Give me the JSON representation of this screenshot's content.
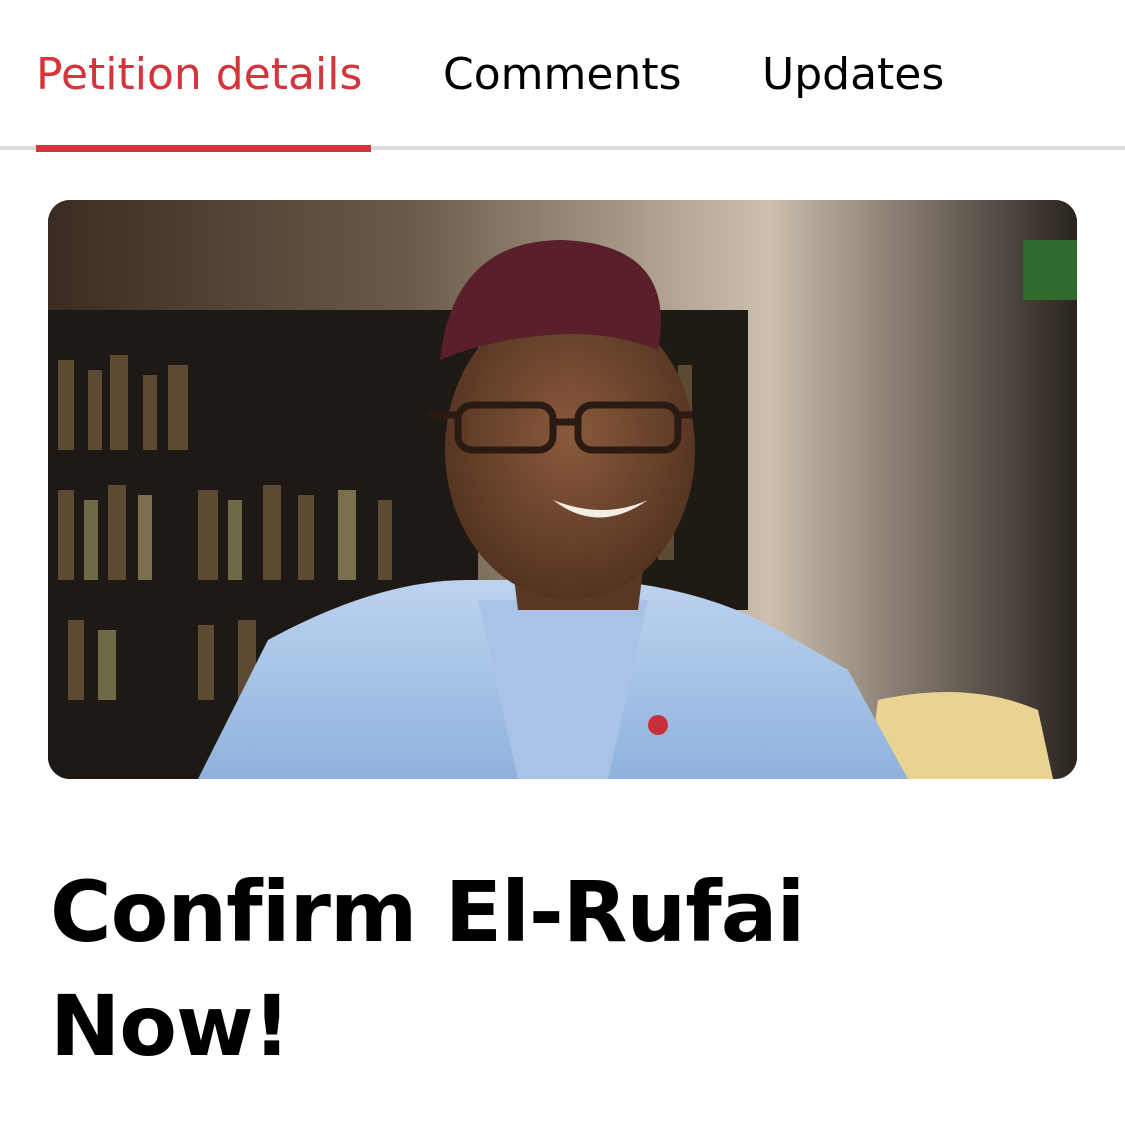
{
  "tabs": [
    {
      "label": "Petition details",
      "active": true
    },
    {
      "label": "Comments",
      "active": false
    },
    {
      "label": "Updates",
      "active": false
    }
  ],
  "colors": {
    "accent": "#d4343a",
    "text": "#000000",
    "divider": "#dcdcdc"
  },
  "petition": {
    "title": "Confirm El-Rufai Now!",
    "image": {
      "subject": "smiling man in maroon cap and light-blue attire in front of bookshelves"
    }
  }
}
